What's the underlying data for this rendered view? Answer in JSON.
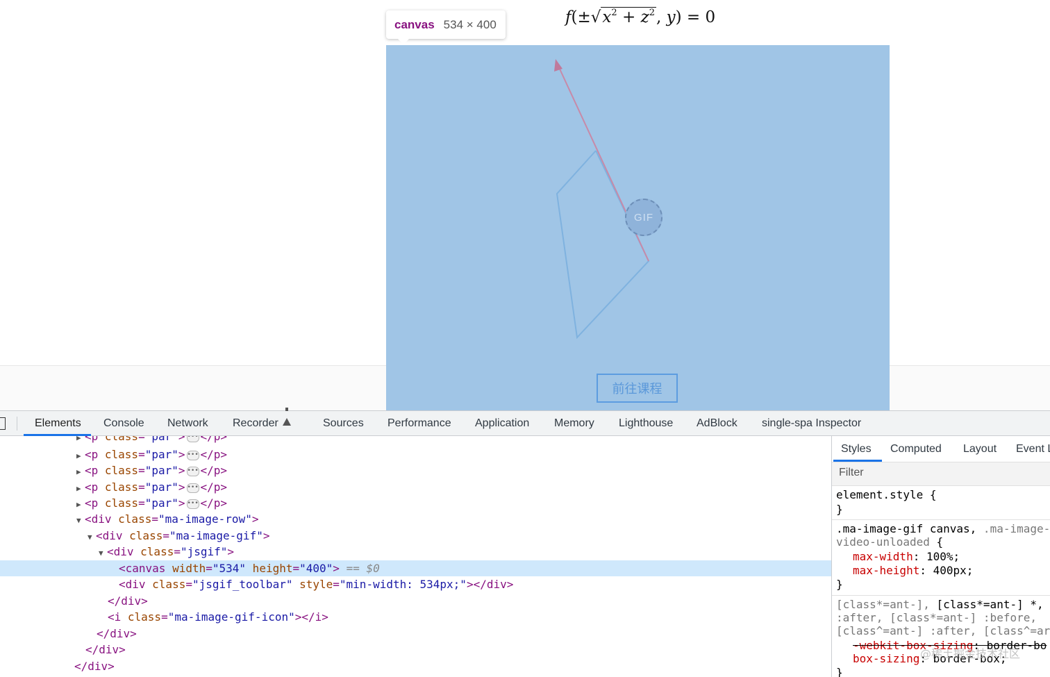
{
  "page": {
    "formula": {
      "func": "f",
      "open": "(±",
      "radicand_a": "x",
      "radicand_b": "z",
      "exponent": "2",
      "plus": " + ",
      "rest_var": "y",
      "rest_close": ") = 0"
    },
    "canvas_tooltip": {
      "tag": "canvas",
      "size": "534 × 400"
    },
    "gif_badge": "GIF",
    "course_button": "前往课程"
  },
  "devtools": {
    "tabs": [
      "Elements",
      "Console",
      "Network",
      "Recorder",
      "Sources",
      "Performance",
      "Application",
      "Memory",
      "Lighthouse",
      "AdBlock",
      "single-spa Inspector"
    ],
    "active_tab": "Elements",
    "elements_lines": {
      "p_open": "<p",
      "class_attr": " class",
      "eq": "=",
      "par_val": "\"par\"",
      "close_gt": ">",
      "p_close": "</p>",
      "div_open": "<div",
      "div_close": "</div>",
      "gt": ">",
      "row_val": "\"ma-image-row\"",
      "gif_val": "\"ma-image-gif\"",
      "jsgif_val": "\"jsgif\"",
      "canvas_open": "<canvas",
      "width_attr": " width",
      "width_val": "\"534\"",
      "height_attr": " height",
      "height_val": "\"400\"",
      "canvas_gt": ">",
      "dollar": " == $0",
      "toolbar_val": "\"jsgif_toolbar\"",
      "style_attr": " style",
      "style_val": "\"min-width: 534px;\"",
      "div_end_inline": "></div>",
      "i_open": "<i",
      "icon_val": "\"ma-image-gif-icon\"",
      "i_end": "></i>"
    },
    "styles_panel": {
      "tabs": [
        "Styles",
        "Computed",
        "Layout",
        "Event L"
      ],
      "filter_placeholder": "Filter",
      "rule1_selector": "element.style {",
      "rule1_close": "}",
      "rule2_selector": ".ma-image-gif canvas,",
      "rule2_selector_grey": " .ma-image-",
      "rule2_selector2": "video-unloaded {",
      "rule2_prop1": "max-width",
      "rule2_val1": ": 100%;",
      "rule2_prop2": "max-height",
      "rule2_val2": ": 400px;",
      "rule2_close": "}",
      "rule3_l1_grey": "[class*=ant-],",
      "rule3_l1_rest": " [class*=ant-] *,",
      "rule3_l2": ":after, [class*=ant-] :before,",
      "rule3_l3": "[class^=ant-] :after, [class^=ar",
      "rule3_prop1": "-webkit-box-sizing",
      "rule3_val1": ": border-bo",
      "rule3_prop2": "box-sizing",
      "rule3_val2": ": border-box;",
      "rule3_close": "}"
    }
  },
  "watermark": "@稀土掘金技术社区",
  "colors": {
    "canvas_overlay": "#a0c5e6",
    "devtools_accent": "#1a73e8",
    "selected_row": "#cfe8fc"
  }
}
